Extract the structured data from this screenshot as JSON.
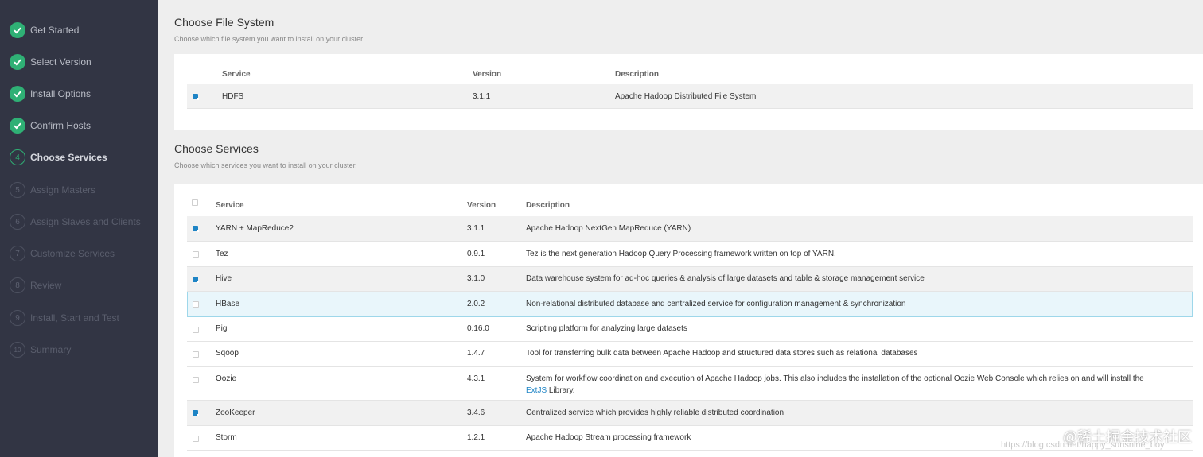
{
  "sidebar": {
    "steps": [
      {
        "num": "1",
        "label": "Get Started",
        "state": "done"
      },
      {
        "num": "2",
        "label": "Select Version",
        "state": "done"
      },
      {
        "num": "3",
        "label": "Install Options",
        "state": "done"
      },
      {
        "num": "3",
        "label": "Confirm Hosts",
        "state": "done"
      },
      {
        "num": "4",
        "label": "Choose Services",
        "state": "current"
      },
      {
        "num": "5",
        "label": "Assign Masters",
        "state": "todo"
      },
      {
        "num": "6",
        "label": "Assign Slaves and Clients",
        "state": "todo"
      },
      {
        "num": "7",
        "label": "Customize Services",
        "state": "todo"
      },
      {
        "num": "8",
        "label": "Review",
        "state": "todo"
      },
      {
        "num": "9",
        "label": "Install, Start and Test",
        "state": "todo"
      },
      {
        "num": "10",
        "label": "Summary",
        "state": "todo"
      }
    ]
  },
  "file_system": {
    "title": "Choose File System",
    "subtitle": "Choose which file system you want to install on your cluster.",
    "headers": {
      "service": "Service",
      "version": "Version",
      "description": "Description"
    },
    "rows": [
      {
        "service": "HDFS",
        "version": "3.1.1",
        "description": "Apache Hadoop Distributed File System",
        "checked": true
      }
    ]
  },
  "services": {
    "title": "Choose Services",
    "subtitle": "Choose which services you want to install on your cluster.",
    "headers": {
      "service": "Service",
      "version": "Version",
      "description": "Description"
    },
    "rows": [
      {
        "service": "YARN + MapReduce2",
        "version": "3.1.1",
        "description": "Apache Hadoop NextGen MapReduce (YARN)",
        "checked": true
      },
      {
        "service": "Tez",
        "version": "0.9.1",
        "description": "Tez is the next generation Hadoop Query Processing framework written on top of YARN.",
        "checked": false
      },
      {
        "service": "Hive",
        "version": "3.1.0",
        "description": "Data warehouse system for ad-hoc queries & analysis of large datasets and table & storage management service",
        "checked": true
      },
      {
        "service": "HBase",
        "version": "2.0.2",
        "description": "Non-relational distributed database and centralized service for configuration management & synchronization",
        "checked": false
      },
      {
        "service": "Pig",
        "version": "0.16.0",
        "description": "Scripting platform for analyzing large datasets",
        "checked": false
      },
      {
        "service": "Sqoop",
        "version": "1.4.7",
        "description": "Tool for transferring bulk data between Apache Hadoop and structured data stores such as relational databases",
        "checked": false
      },
      {
        "service": "Oozie",
        "version": "4.3.1",
        "description": "System for workflow coordination and execution of Apache Hadoop jobs. This also includes the installation of the optional Oozie Web Console which relies on and will install the",
        "description_link": "ExtJS",
        "description_tail": " Library.",
        "checked": false
      },
      {
        "service": "ZooKeeper",
        "version": "3.4.6",
        "description": "Centralized service which provides highly reliable distributed coordination",
        "checked": true
      },
      {
        "service": "Storm",
        "version": "1.2.1",
        "description": "Apache Hadoop Stream processing framework",
        "checked": false
      }
    ]
  },
  "watermark": {
    "site": "@稀土掘金技术社区",
    "url": "https://blog.csdn.net/happy_sunshine_boy"
  },
  "colors": {
    "sidebar_bg": "#323544",
    "done_green": "#2fb075",
    "checkbox_blue": "#1e84c5",
    "highlight_row": "#e9f6fb"
  }
}
